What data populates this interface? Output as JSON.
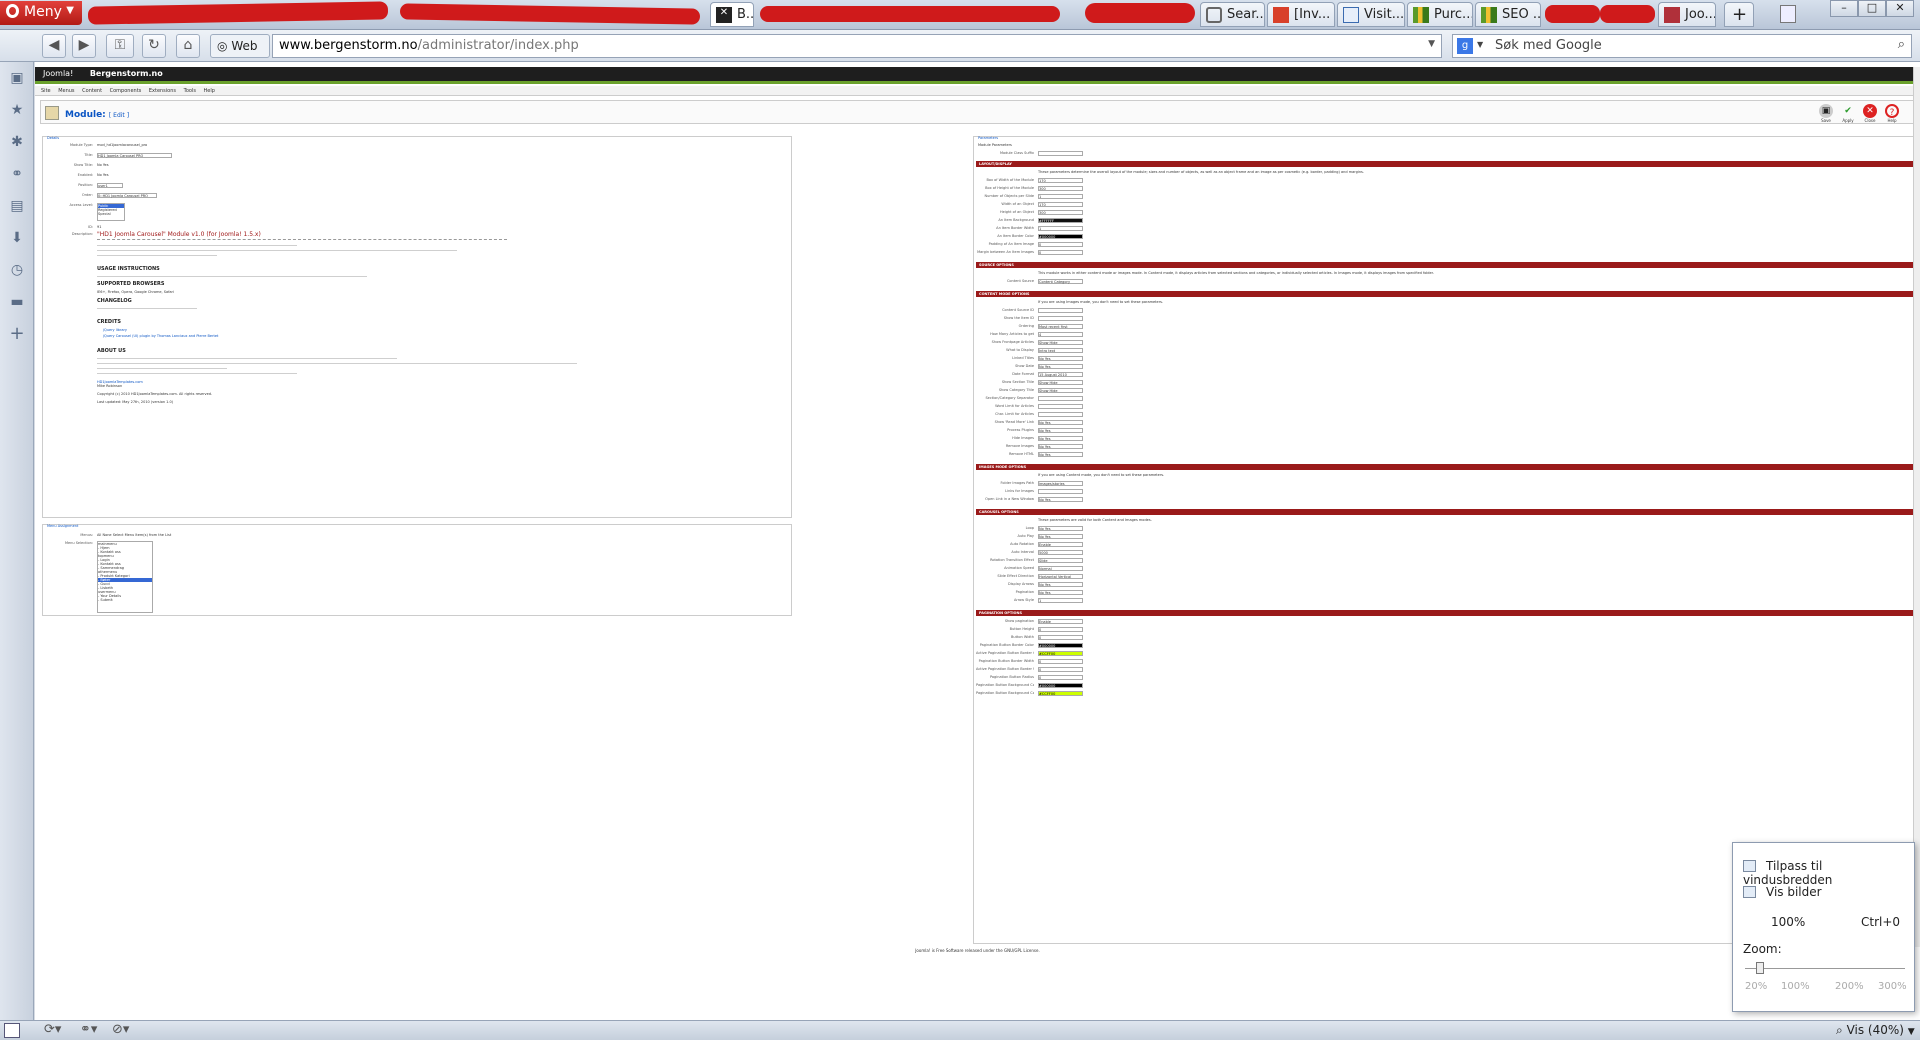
{
  "browser": {
    "menu_label": "Meny",
    "tabs": [
      {
        "label": "B...",
        "active": true
      },
      {
        "label": "Sear..."
      },
      {
        "label": "[Inv..."
      },
      {
        "label": "Visit..."
      },
      {
        "label": "Purc..."
      },
      {
        "label": "SEO ..."
      },
      {
        "label": "Joo..."
      }
    ],
    "web_label": "Web",
    "url_domain": "www.bergenstorm.no",
    "url_path": "/administrator/index.php",
    "search_placeholder": "Søk med Google",
    "colors": {
      "accent": "#b21a15",
      "chrome": "#c8d1de"
    }
  },
  "joomla": {
    "site_name": "Bergenstorm.no",
    "logo_text": "Joomla!",
    "menu_items": [
      "Site",
      "Menus",
      "Content",
      "Components",
      "Extensions",
      "Tools",
      "Help"
    ],
    "page_title": "Module:",
    "page_subtitle": "[ Edit ]",
    "toolbar": {
      "save": "Save",
      "apply": "Apply",
      "close": "Close",
      "help": "Help"
    },
    "details": {
      "heading": "Details",
      "fields": [
        {
          "label": "Module Type:",
          "value": "mod_hd1joomlacarousel_pro"
        },
        {
          "label": "Title:",
          "value": "HD1 Joomla Carousel PRO"
        },
        {
          "label": "Show Title:",
          "value": "No  Yes"
        },
        {
          "label": "Enabled:",
          "value": "No  Yes"
        },
        {
          "label": "Position:",
          "value": "user1"
        },
        {
          "label": "Order:",
          "value": "0::HD1 Joomla Carousel PRO"
        },
        {
          "label": "Access Level:",
          "value": "Public"
        },
        {
          "label": "ID:",
          "value": "91"
        }
      ],
      "access_options": [
        "Public",
        "Registered",
        "Special"
      ],
      "description_title": "\"HD1 Joomla Carousel\" Module v1.0 (for Joomla! 1.5.x)",
      "sections": [
        "USAGE INSTRUCTIONS",
        "SUPPORTED BROWSERS",
        "CHANGELOG",
        "CREDITS",
        "ABOUT US"
      ],
      "browsers": "IE6+, Firefox, Opera, Google Chrome, Safari",
      "credits": [
        "jQuery library",
        "jQuery Carousel (UI) plugin by Thomas Lanciaux and Pierre Bertet"
      ],
      "footer_lines": [
        "HD1JoomlaTemplates.com",
        "Mike Robinson",
        "Copyright (c) 2010 HD1JoomlaTemplates.com. All rights reserved.",
        "Last updated: May 27th, 2010 (version 1.0)"
      ]
    },
    "menu_assignment": {
      "heading": "Menu Assignment",
      "menus_label": "Menus:",
      "menus_options": "All  None  Select Menu Item(s) from the List",
      "selection_label": "Menu Selection:",
      "items": [
        "mainmenu",
        "- Hjem",
        "- Kontakt oss",
        "topmenu",
        "- Login",
        "- Kontakt oss",
        "- Sammendrag",
        "othermenu",
        "- Produkt Kategori",
        "- Bøker",
        "- Gucci",
        "- Lisbeth",
        "usermenu",
        "- Your Details",
        "- Submit"
      ]
    },
    "parameters": {
      "heading": "Parameters",
      "module_params_label": "Module Parameters",
      "suffix_label": "Module Class Suffix",
      "sections": [
        {
          "title": "LAYOUT/DISPLAY",
          "intro": "These parameters determine the overall layout of the module; sizes and number of objects, as well as an object frame and an image as per cosmetic (e.g. border, padding) and margins.",
          "fields": [
            [
              "Box of Width of the Module",
              "170"
            ],
            [
              "Box of Height of the Module",
              "300"
            ],
            [
              "Number of Objects per Slide",
              "1"
            ],
            [
              "Width of an Object",
              "170"
            ],
            [
              "Height of an Object",
              "300"
            ],
            [
              "An Item Background",
              "#FFFFFF"
            ],
            [
              "An Item Border Width",
              "1"
            ],
            [
              "An Item Border Color",
              "#000000"
            ],
            [
              "Padding of An Item Image",
              "0"
            ],
            [
              "Margin between An Item Images",
              "0"
            ]
          ]
        },
        {
          "title": "SOURCE OPTIONS",
          "intro": "This module works in either content mode or images mode. In Content mode, it displays articles from selected sections and categories, or individually selected articles. In Images mode, it displays images from specified folder.",
          "fields": [
            [
              "Content Source",
              "Content Category"
            ]
          ]
        },
        {
          "title": "CONTENT MODE OPTIONS",
          "intro": "If you are using Images mode, you don't need to set these parameters.",
          "fields": [
            [
              "Content Source ID",
              ""
            ],
            [
              "Show the Item ID",
              ""
            ],
            [
              "Ordering",
              "Most recent first"
            ],
            [
              "How Many Articles to get",
              "4"
            ],
            [
              "Show Frontpage Articles",
              "Show  Hide"
            ],
            [
              "What to Display",
              "Intro text"
            ],
            [
              "Linked Titles",
              "No  Yes"
            ],
            [
              "Show Date",
              "No  Yes"
            ],
            [
              "Date Format",
              "15 August 2010"
            ],
            [
              "Show Section Title",
              "Show  Hide"
            ],
            [
              "Show Category Title",
              "Show  Hide"
            ],
            [
              "Section/Category Separator",
              ""
            ],
            [
              "Word Limit for Articles",
              ""
            ],
            [
              "Char. Limit for Articles",
              ""
            ],
            [
              "Show 'Read More' Link",
              "No  Yes"
            ],
            [
              "Process Plugins",
              "No  Yes"
            ],
            [
              "Hide Images",
              "No  Yes"
            ],
            [
              "Remove Images",
              "No  Yes"
            ],
            [
              "Remove HTML",
              "No  Yes"
            ]
          ]
        },
        {
          "title": "IMAGES MODE OPTIONS",
          "intro": "If you are using Content mode, you don't need to set these parameters.",
          "fields": [
            [
              "Folder Images Path",
              "images/stories"
            ],
            [
              "Links for Images",
              ""
            ],
            [
              "Open Link in a New Window",
              "No  Yes"
            ]
          ]
        },
        {
          "title": "CAROUSEL OPTIONS",
          "intro": "These parameters are valid for both Content and Images modes.",
          "fields": [
            [
              "Loop",
              "No  Yes"
            ],
            [
              "Auto Play",
              "No  Yes"
            ],
            [
              "Auto Rotation",
              "Enable"
            ],
            [
              "Auto Interval",
              "5000"
            ],
            [
              "Rotation Transition Effect",
              "Slide"
            ],
            [
              "Animation Speed",
              "Normal"
            ],
            [
              "Slide Effect Direction",
              "Horizontal  Vertical"
            ],
            [
              "Display Arrows",
              "No  Yes"
            ],
            [
              "Pagination",
              "No  Yes"
            ],
            [
              "Arrow Style",
              "1"
            ]
          ]
        },
        {
          "title": "PAGINATION OPTIONS",
          "intro": "",
          "fields": [
            [
              "Show pagination",
              "Enable"
            ],
            [
              "Button Height",
              "0"
            ],
            [
              "Button Width",
              "0"
            ],
            [
              "Pagination Button Border Color",
              "#000000"
            ],
            [
              "Active Pagination Button Border Color",
              "#CCFF00"
            ],
            [
              "Pagination Button Border Width",
              "0"
            ],
            [
              "Active Pagination Button Border Width",
              "0"
            ],
            [
              "Pagination Button Radius",
              "0"
            ],
            [
              "Pagination Button Background Color",
              "#000000"
            ],
            [
              "Pagination Button Background Color",
              "#CCFF00"
            ]
          ]
        }
      ]
    },
    "footer": "Joomla! is Free Software released under the GNU/GPL License."
  },
  "zoom_popup": {
    "fit_width": "Tilpass til vindusbredden",
    "show_images": "Vis bilder",
    "zoom_value": "100%",
    "shortcut": "Ctrl+0",
    "zoom_label": "Zoom:",
    "ticks": [
      "20%",
      "100%",
      "200%",
      "300%"
    ],
    "zoom_fraction": 0.4
  },
  "status": {
    "zoom_display": "Vis (40%)"
  }
}
